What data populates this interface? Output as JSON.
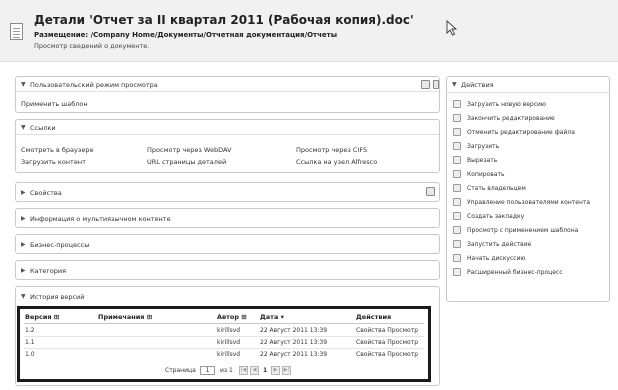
{
  "header": {
    "title": "Детали 'Отчет за II квартал 2011 (Рабочая копия).doc'",
    "location": "Размещение: /Company Home/Документы/Отчетная документация/Отчеты",
    "subtitle": "Просмотр сведений о документе."
  },
  "view_mode": {
    "title": "Пользовательский режим просмотра",
    "apply_template": "Применить шаблон"
  },
  "links": {
    "title": "Ссылки",
    "items": [
      "Смотреть в браузере",
      "Просмотр через WebDAV",
      "Просмотр через CIFS",
      "Загрузить контент",
      "URL страницы деталей",
      "Ссылка на узел Alfresco"
    ]
  },
  "properties": {
    "title": "Свойства"
  },
  "multilingual": {
    "title": "Информация о мультиязычном контенте"
  },
  "workflows": {
    "title": "Бизнес-процессы"
  },
  "categories": {
    "title": "Категория"
  },
  "history": {
    "title": "История версий",
    "columns": [
      "Версия ⊞",
      "Примечания ⊞",
      "Автор ⊞",
      "Дата ▾",
      "Действия"
    ],
    "rows": [
      [
        "1.2",
        "kirillsvd",
        "22 Август 2011 13:39",
        "Свойства Просмотр"
      ],
      [
        "1.1",
        "kirillsvd",
        "22 Август 2011 13:39",
        "Свойства Просмотр"
      ],
      [
        "1.0",
        "kirillsvd",
        "22 Август 2011 13:39",
        "Свойства Просмотр"
      ]
    ],
    "pager": {
      "label": "Страница",
      "page": "1",
      "of": "из 1",
      "current": "1"
    }
  },
  "actions": {
    "title": "Действия",
    "items": [
      "Загрузить новую версию",
      "Закончить редактирование",
      "Отменить редактирование файла",
      "Загрузить",
      "Вырезать",
      "Копировать",
      "Стать владельцем",
      "Управление пользователями контента",
      "Создать закладку",
      "Просмотр с применением шаблона",
      "Запустить действие",
      "Начать дискуссию",
      "Расширенный бизнес-процесс"
    ]
  }
}
